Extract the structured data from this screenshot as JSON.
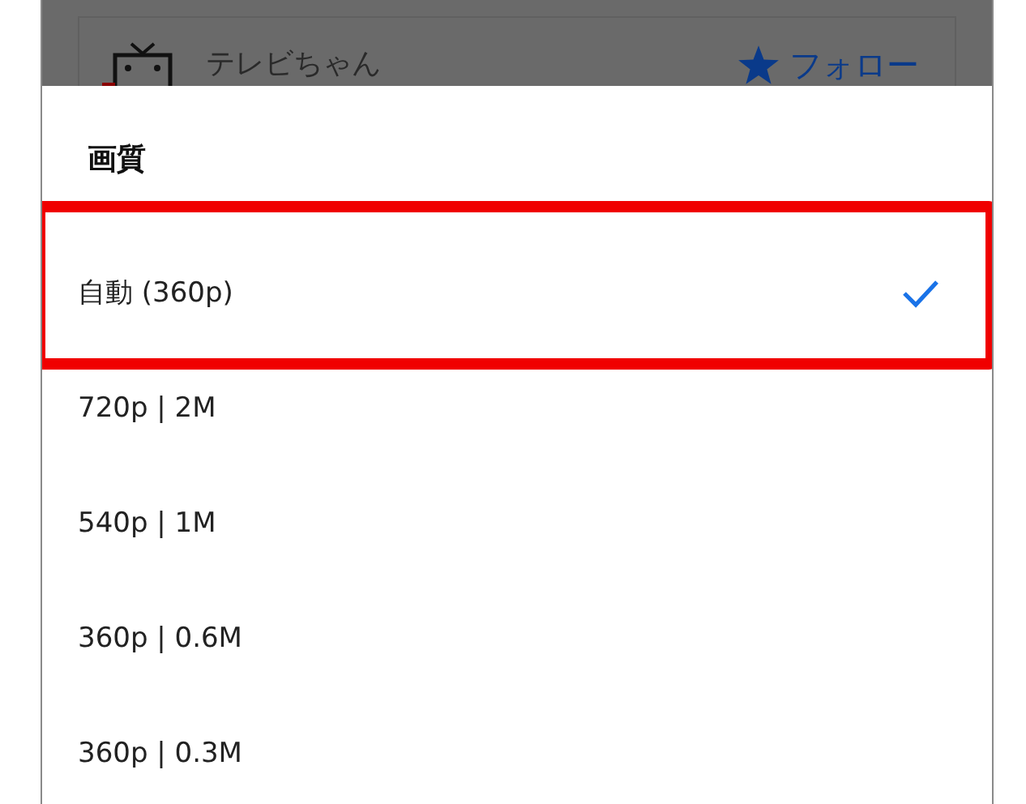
{
  "background": {
    "channel_name": "テレビちゃん",
    "follow_button": "フォロー"
  },
  "sheet": {
    "title": "画質",
    "options": [
      {
        "label": "自動 (360p)",
        "selected": true,
        "highlighted": true
      },
      {
        "label": "720p | 2M",
        "selected": false,
        "highlighted": false
      },
      {
        "label": "540p | 1M",
        "selected": false,
        "highlighted": false
      },
      {
        "label": "360p | 0.6M",
        "selected": false,
        "highlighted": false
      },
      {
        "label": "360p | 0.3M",
        "selected": false,
        "highlighted": false
      }
    ]
  }
}
